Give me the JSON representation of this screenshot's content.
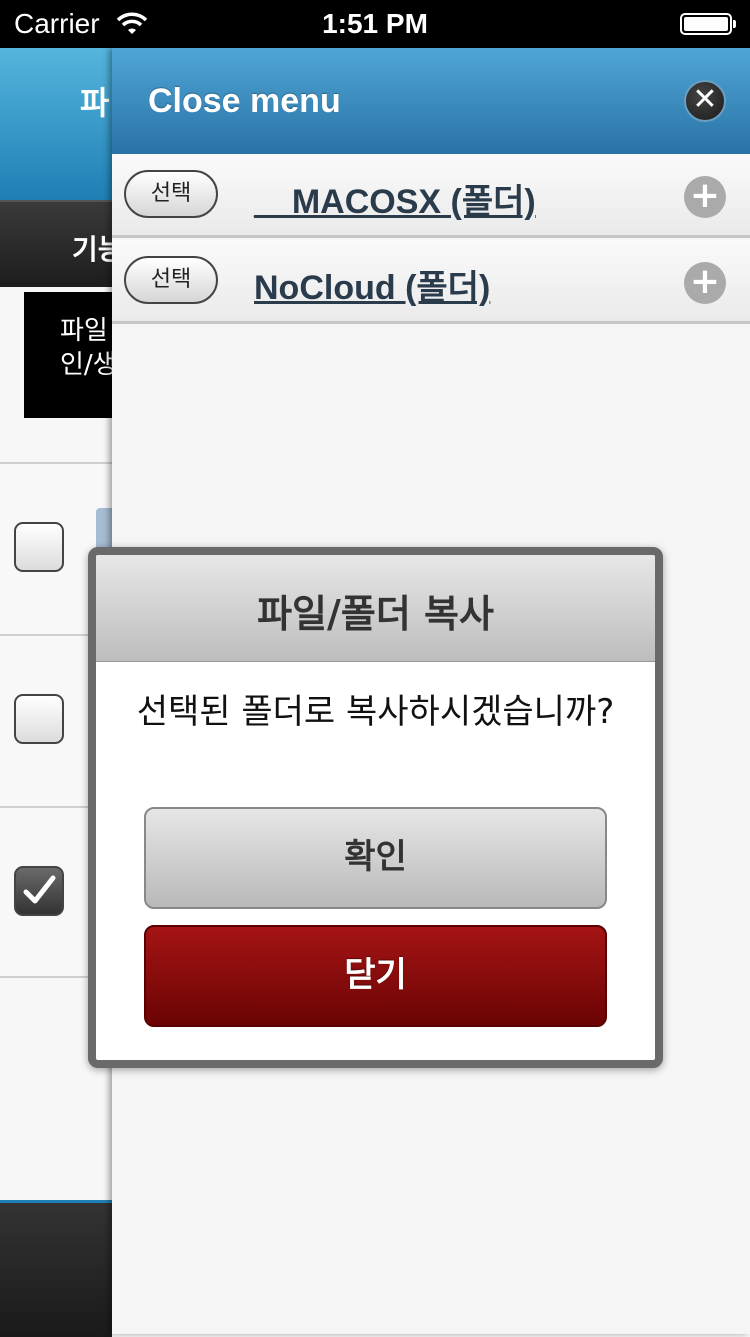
{
  "status_bar": {
    "carrier": "Carrier",
    "time": "1:51 PM"
  },
  "background_page": {
    "header_title": "파",
    "tab_label": "기능",
    "notice_text": "파일\n인/생"
  },
  "menu": {
    "title": "Close menu",
    "close_icon": "close-icon",
    "folders": [
      {
        "select_label": "선택",
        "name": "__MACOSX (폴더)"
      },
      {
        "select_label": "선택",
        "name": "NoCloud (폴더)"
      }
    ]
  },
  "dialog": {
    "title": "파일/폴더 복사",
    "message": "선택된 폴더로 복사하시겠습니까?",
    "confirm_label": "확인",
    "close_label": "닫기"
  },
  "colors": {
    "header_blue": "#2a72a6",
    "close_button_red": "#8b0c0c"
  }
}
